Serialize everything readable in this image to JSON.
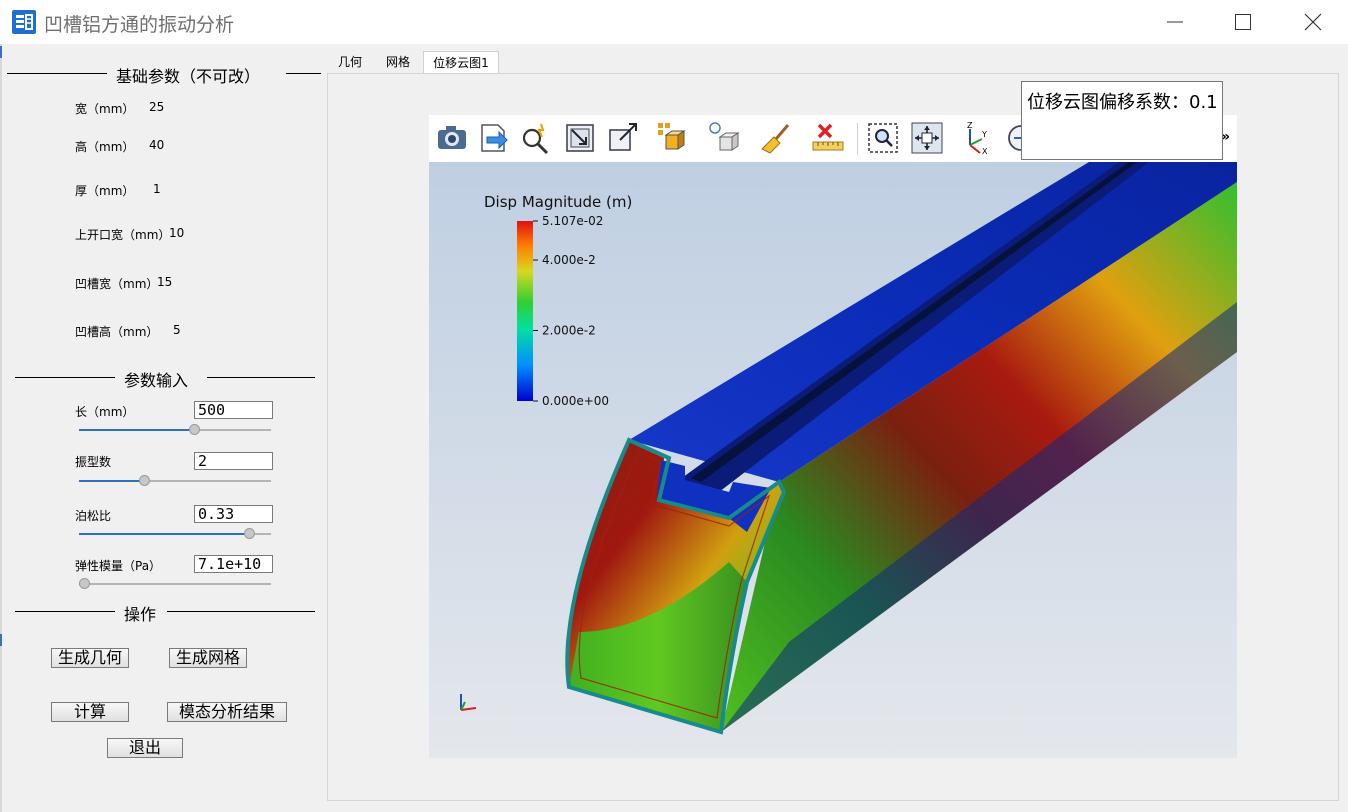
{
  "window": {
    "title": "凹槽铝方通的振动分析",
    "accent": "#1f6fd1"
  },
  "base_params": {
    "title": "基础参数（不可改）",
    "rows": [
      {
        "label": "宽（mm）",
        "value": "25"
      },
      {
        "label": "高（mm）",
        "value": "40"
      },
      {
        "label": "厚（mm）",
        "value": "1"
      },
      {
        "label": "上开口宽（mm）",
        "value": "10"
      },
      {
        "label": "凹槽宽（mm）",
        "value": "15"
      },
      {
        "label": "凹槽高（mm）",
        "value": "5"
      }
    ]
  },
  "inputs": {
    "title": "参数输入",
    "fields": [
      {
        "label": "长（mm）",
        "value": "500",
        "slider_fraction": 0.61
      },
      {
        "label": "振型数",
        "value": "2",
        "slider_fraction": 0.33
      },
      {
        "label": "泊松比",
        "value": "0.33",
        "slider_fraction": 0.91
      },
      {
        "label": "弹性模量（Pa）",
        "value": "7.1e+10",
        "slider_fraction": 0.0
      }
    ]
  },
  "operations": {
    "title": "操作",
    "generate_geometry": "生成几何",
    "generate_mesh": "生成网格",
    "compute": "计算",
    "modal_results": "模态分析结果",
    "exit": "退出"
  },
  "tabs": [
    "几何",
    "网格",
    "位移云图1"
  ],
  "active_tab": 2,
  "toolbar_icons": [
    "camera-icon",
    "export-icon",
    "interact-select-icon",
    "reset-camera-icon",
    "zoom-to-data-icon",
    "representation-icon",
    "light-icon",
    "clear-icon",
    "ruler-icon",
    "zoom-box-icon",
    "pan-icon",
    "axes-orientation-icon",
    "rotate-icon"
  ],
  "legend": {
    "title": "Disp Magnitude (m)",
    "ticks": [
      "5.107e-02",
      "4.000e-2",
      "2.000e-2",
      "0.000e+00"
    ],
    "tick_values": [
      0.05107,
      0.04,
      0.02,
      0.0
    ],
    "colormap": [
      "#0000d0",
      "#00a0ff",
      "#00e090",
      "#30d030",
      "#d8d820",
      "#ff8000",
      "#e01010"
    ]
  },
  "tooltip": "位移云图偏移系数：0.1",
  "more_label": "»"
}
